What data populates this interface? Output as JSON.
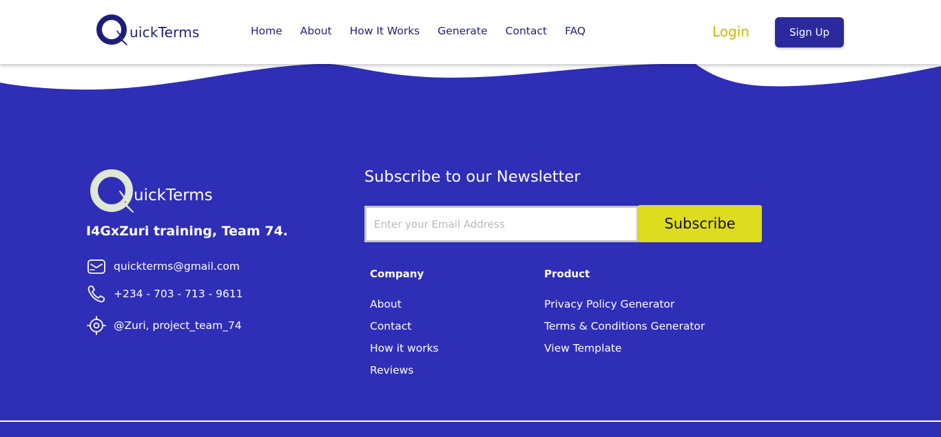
{
  "header": {
    "logo_text": "uickTerms",
    "nav": [
      "Home",
      "About",
      "How It Works",
      "Generate",
      "Contact",
      "FAQ"
    ],
    "login_label": "Login",
    "signup_label": "Sign Up"
  },
  "footer": {
    "logo_text": "uickTerms",
    "team": "I4GxZuri training, Team 74.",
    "contacts": {
      "email": "quickterms@gmail.com",
      "phone": "+234 - 703 - 713 - 9611",
      "social": "@Zuri, project_team_74"
    },
    "newsletter": {
      "title": "Subscribe to our Newsletter",
      "placeholder": "Enter your Email Address",
      "button_label": "Subscribe"
    },
    "company": {
      "heading": "Company",
      "links": [
        "About",
        "Contact",
        "How it works",
        "Reviews"
      ]
    },
    "product": {
      "heading": "Product",
      "links": [
        "Privacy Policy Generator",
        "Terms & Conditions Generator",
        "View Template"
      ]
    }
  },
  "colors": {
    "brand_blue": "#2f2eb7",
    "navy": "#1e1e7a",
    "accent_yellow": "#dedc1f",
    "login_yellow": "#c6c11a"
  },
  "icons": [
    "mail-icon",
    "phone-icon",
    "location-icon",
    "lightning-bolt-icon"
  ]
}
